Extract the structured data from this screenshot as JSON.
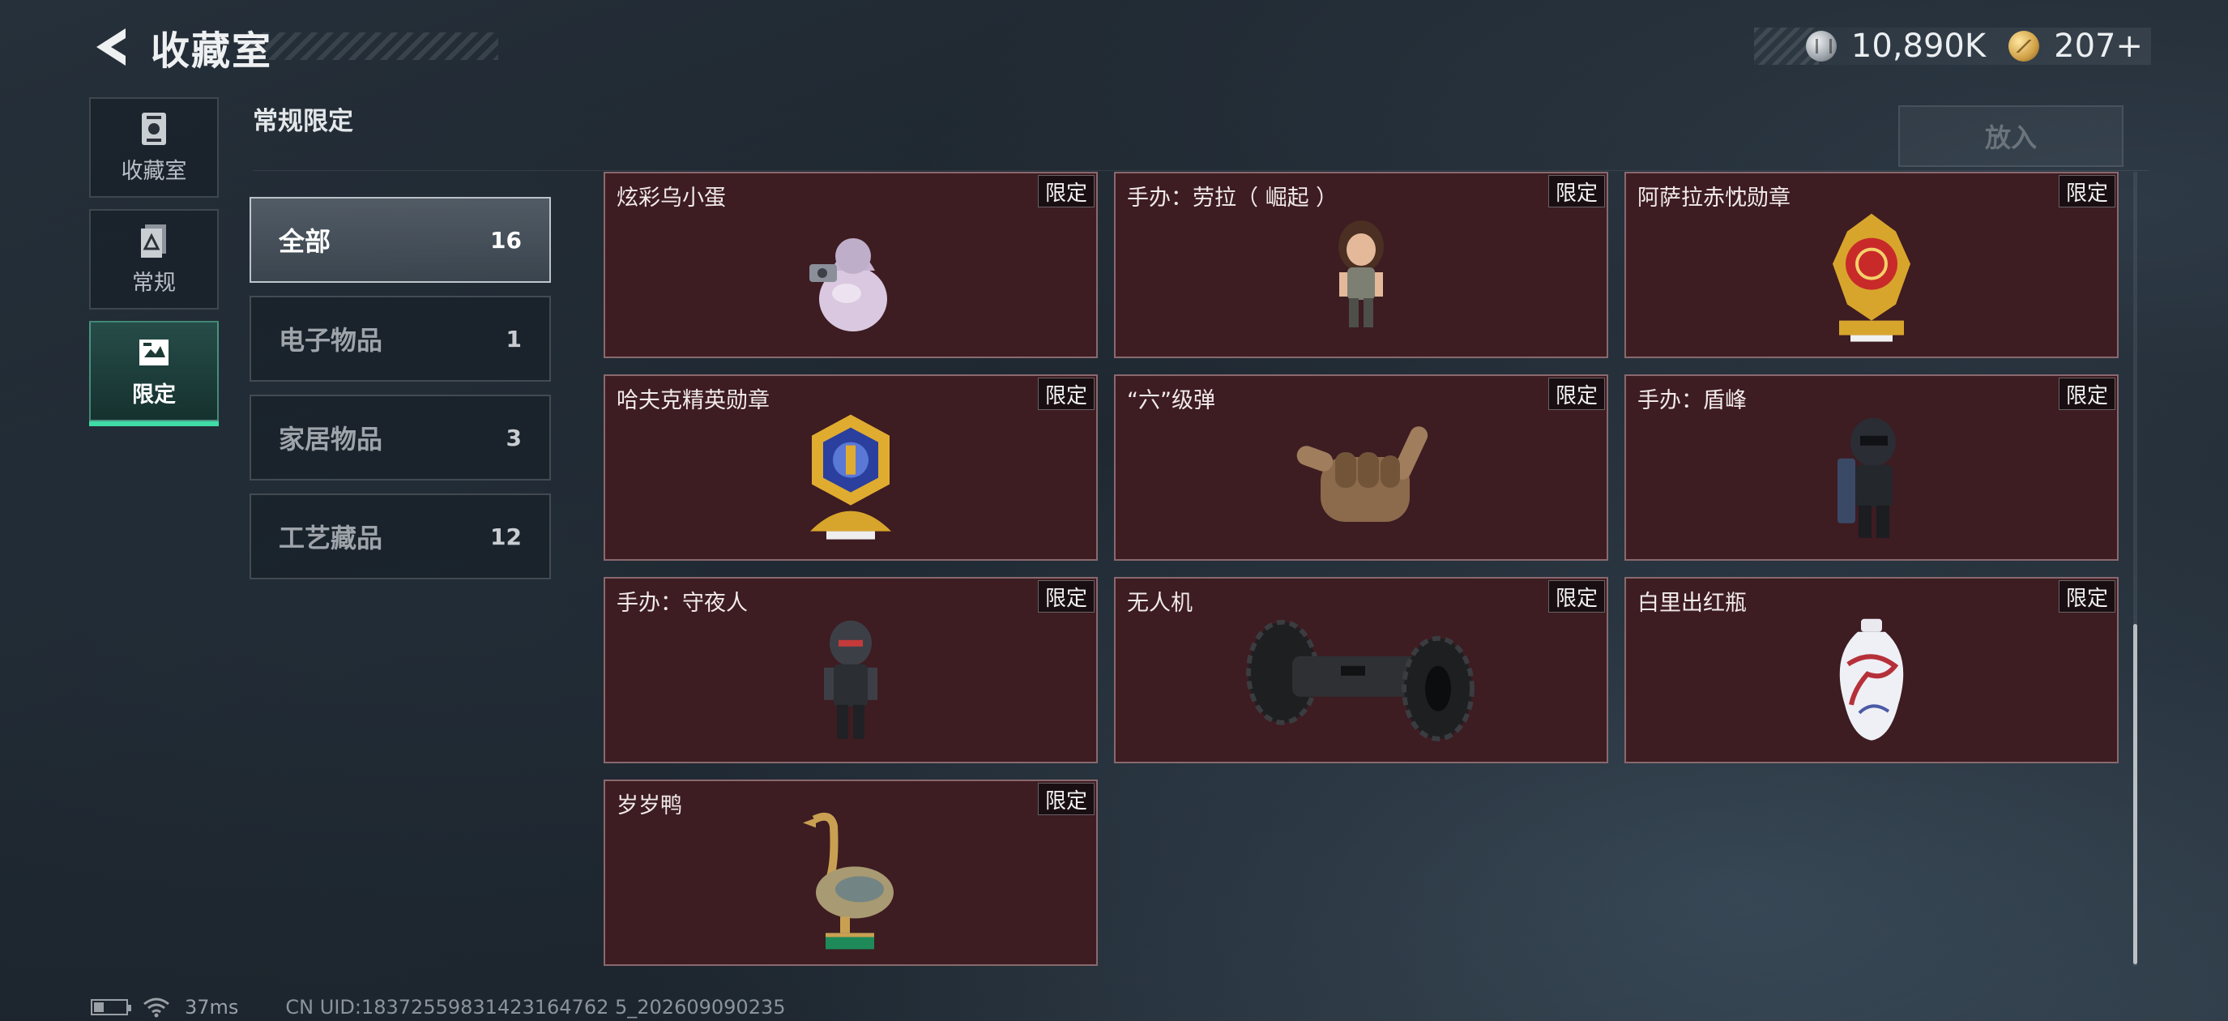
{
  "header": {
    "title": "收藏室",
    "currency": [
      {
        "icon": "silver-coin-icon",
        "value": "10,890K"
      },
      {
        "icon": "gold-coin-icon",
        "value": "207+"
      }
    ]
  },
  "side_nav": {
    "items": [
      {
        "label": "收藏室",
        "icon": "collection-room-icon",
        "active": false
      },
      {
        "label": "常规",
        "icon": "regular-icon",
        "active": false
      },
      {
        "label": "限定",
        "icon": "limited-icon",
        "active": true
      }
    ]
  },
  "section_title": "常规限定",
  "place_button": "放入",
  "categories": [
    {
      "label": "全部",
      "count": "16",
      "active": true
    },
    {
      "label": "电子物品",
      "count": "1",
      "active": false
    },
    {
      "label": "家居物品",
      "count": "3",
      "active": false
    },
    {
      "label": "工艺藏品",
      "count": "12",
      "active": false
    }
  ],
  "items": [
    {
      "name": "炫彩乌小蛋",
      "badge": "限定",
      "art": "egg-figure-icon"
    },
    {
      "name": "手办：劳拉（ 崛起 ）",
      "badge": "限定",
      "art": "lara-figure-icon"
    },
    {
      "name": "阿萨拉赤忱勋章",
      "badge": "限定",
      "art": "gold-medal-icon"
    },
    {
      "name": "哈夫克精英勋章",
      "badge": "限定",
      "art": "hexagon-medal-icon"
    },
    {
      "name": "“六”级弹",
      "badge": "限定",
      "art": "hand-sign-icon"
    },
    {
      "name": "手办：盾峰",
      "badge": "限定",
      "art": "shield-soldier-figure-icon"
    },
    {
      "name": "手办：守夜人",
      "badge": "限定",
      "art": "nightwatch-figure-icon"
    },
    {
      "name": "无人机",
      "badge": "限定",
      "art": "drone-wheels-icon"
    },
    {
      "name": "白里出红瓶",
      "badge": "限定",
      "art": "porcelain-vase-icon"
    },
    {
      "name": "岁岁鸭",
      "badge": "限定",
      "art": "duck-statue-icon"
    }
  ],
  "status": {
    "ping": "37ms",
    "uid": "CN UID:18372559831423164762 5_202609090235"
  }
}
